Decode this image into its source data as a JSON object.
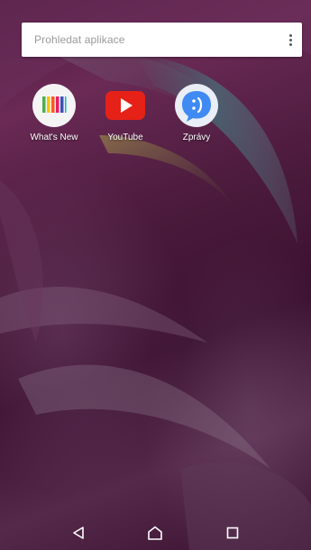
{
  "search": {
    "placeholder": "Prohledat aplikace"
  },
  "apps": [
    {
      "label": "What's New",
      "icon": "whats-new-icon"
    },
    {
      "label": "YouTube",
      "icon": "youtube-icon"
    },
    {
      "label": "Zprávy",
      "icon": "messages-icon"
    }
  ],
  "nav": {
    "back_icon": "back-triangle-icon",
    "home_icon": "home-icon",
    "recents_icon": "recents-square-icon"
  },
  "colors": {
    "youtube_red": "#e62117",
    "messages_blue": "#3f8af3",
    "wallpaper_base": "#4a1a3c"
  }
}
